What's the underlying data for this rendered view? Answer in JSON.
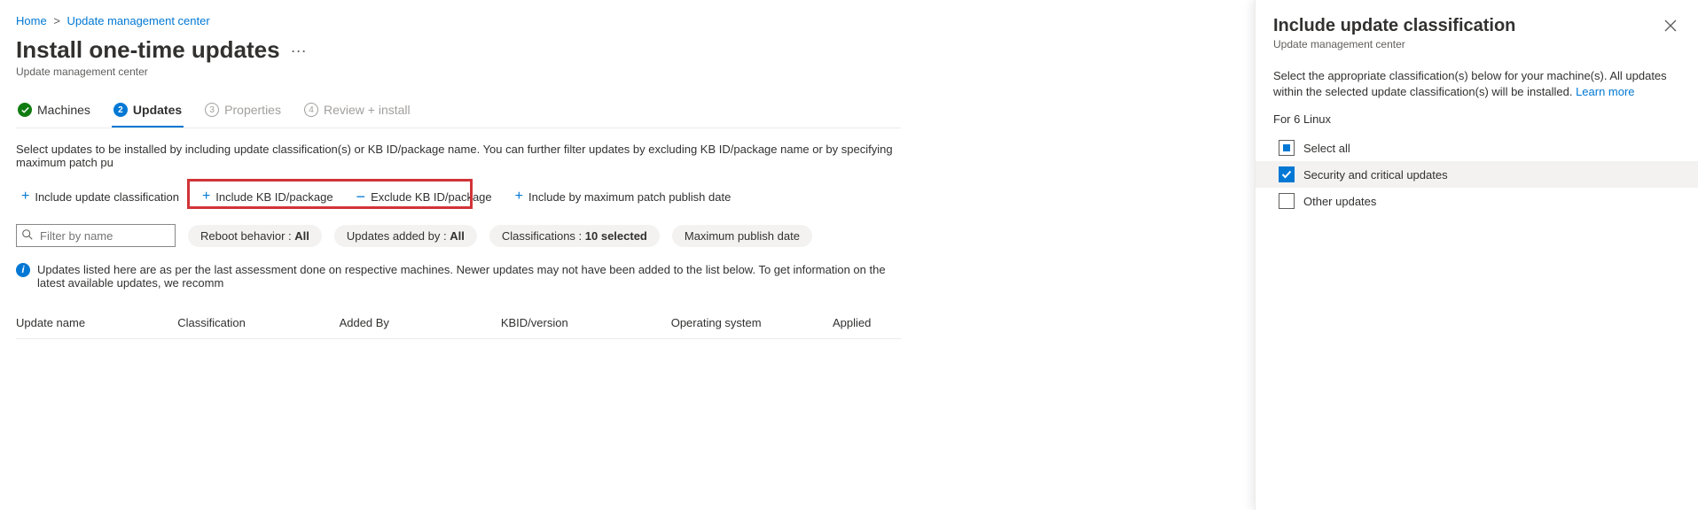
{
  "breadcrumb": {
    "home": "Home",
    "center": "Update management center"
  },
  "page": {
    "title": "Install one-time updates",
    "subtitle": "Update management center "
  },
  "steps": {
    "machines": "Machines",
    "updates": "Updates",
    "properties": "Properties",
    "review": "Review + install",
    "num2": "2",
    "num3": "3",
    "num4": "4"
  },
  "hint": "Select updates to be installed by including update classification(s) or KB ID/package name. You can further filter updates by excluding KB ID/package name or by specifying maximum patch pu",
  "toolbar": {
    "include_classification": "Include update classification",
    "include_kb": "Include KB ID/package",
    "exclude_kb": "Exclude KB ID/package",
    "include_date": "Include by maximum patch publish date"
  },
  "filters": {
    "placeholder": "Filter by name",
    "reboot_label": "Reboot behavior : ",
    "reboot_value": "All",
    "added_label": "Updates added by : ",
    "added_value": "All",
    "class_label": "Classifications : ",
    "class_value": "10 selected",
    "publish_label": "Maximum publish date"
  },
  "info": "Updates listed here are as per the last assessment done on respective machines. Newer updates may not have been added to the list below. To get information on the latest available updates, we recomm",
  "columns": {
    "name": "Update name",
    "classification": "Classification",
    "added_by": "Added By",
    "kb": "KBID/version",
    "os": "Operating system",
    "applied": "Applied"
  },
  "panel": {
    "title": "Include update classification",
    "subtitle": "Update management center",
    "desc": "Select the appropriate classification(s) below for your machine(s). All updates within the selected update classification(s) will be installed. ",
    "learn_more": "Learn more",
    "for": "For 6 Linux",
    "select_all": "Select all",
    "security": "Security and critical updates",
    "other": "Other updates"
  }
}
